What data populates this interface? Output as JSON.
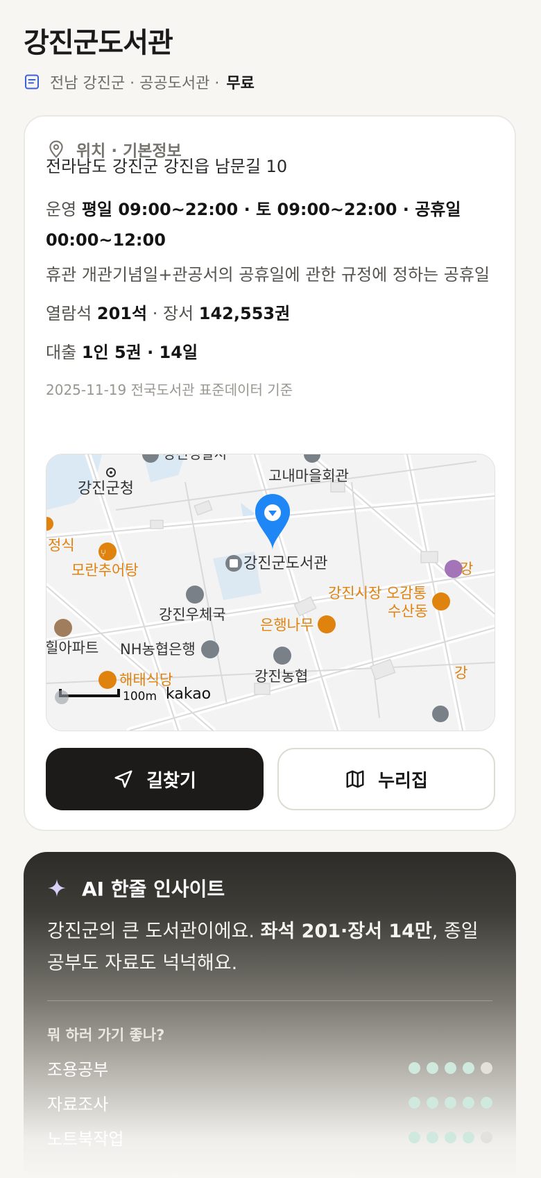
{
  "header": {
    "title": "강진군도서관",
    "subtitle": "전남 강진군 · 공공도서관 ·",
    "fee": "무료"
  },
  "info": {
    "section_title": "위치 · 기본정보",
    "address": "전라남도 강진군 강진읍 남문길 10",
    "hours_label": "운영",
    "hours_value": "평일 09:00~22:00 · 토 09:00~22:00 · 공휴일 00:00~12:00",
    "closed_label": "휴관",
    "closed_value": "개관기념일+관공서의 공휴일에 관한 규정에 정하는 공휴일",
    "seats_label": "열람석",
    "seats_value": "201석",
    "books_label": "· 장서",
    "books_value": "142,553권",
    "loan_label": "대출",
    "loan_value": "1인 5권 · 14일",
    "data_date": "2025-11-19 전국도서관 표준데이터 기준"
  },
  "map": {
    "labels": {
      "gov": "강진군청",
      "top_cut": "강진경찰서",
      "village_hall": "고내마을회관",
      "cut_restaurant": "정식",
      "moran": "모란추어탕",
      "library": "강진군도서관",
      "market": "강진시장 오감통",
      "market2": "수산동",
      "post": "강진우체국",
      "ginkgo": "은행나무",
      "apt": "힐아파트",
      "nh": "NH농협은행",
      "nonghyup": "강진농협",
      "haetae": "해태식당",
      "right_cut": "강",
      "right_cut2": "강"
    },
    "scale": "100m",
    "logo": "kakao",
    "colors": {
      "pin": "#1f87f5",
      "poi_orange": "#e0820e",
      "poi_gray": "#7a8088"
    }
  },
  "buttons": {
    "directions": "길찾기",
    "nurizip": "누리집"
  },
  "ai": {
    "title": "AI 한줄 인사이트",
    "text_pre": "강진군의 큰 도서관이에요. ",
    "text_bold": "좌석 201·장서 14만",
    "text_post": ", 종일 공부도 자료도 넉넉해요.",
    "question": "뭐 하러 가기 좋나?",
    "ratings": [
      {
        "label": "조용공부",
        "score": 4,
        "max": 5
      },
      {
        "label": "자료조사",
        "score": 5,
        "max": 5
      },
      {
        "label": "노트북작업",
        "score": 4,
        "max": 5
      }
    ]
  }
}
